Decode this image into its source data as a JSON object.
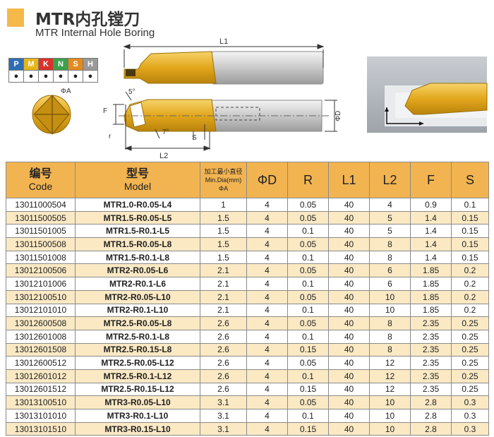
{
  "header": {
    "title_cn": "MTR内孔镗刀",
    "title_en": "MTR Internal Hole Boring",
    "accent_color": "#F5B94A"
  },
  "materials": [
    {
      "letter": "P",
      "color": "#2D6DB5",
      "mark": "●"
    },
    {
      "letter": "M",
      "color": "#E6B617",
      "mark": "●"
    },
    {
      "letter": "K",
      "color": "#D9322B",
      "mark": "●"
    },
    {
      "letter": "N",
      "color": "#3AA24A",
      "mark": "●"
    },
    {
      "letter": "S",
      "color": "#E58A1F",
      "mark": "●"
    },
    {
      "letter": "H",
      "color": "#9A9A9A",
      "mark": "●"
    }
  ],
  "diagram_labels": {
    "l1": "L1",
    "l2": "L2",
    "phi_a": "ΦA",
    "angle5": "5°",
    "angle7": "7°",
    "f": "F",
    "r": "r",
    "s": "S",
    "phi_d": "ΦD"
  },
  "table": {
    "headers": [
      {
        "cn": "编号",
        "en": "Code"
      },
      {
        "cn": "型号",
        "en": "Model"
      },
      {
        "lines": [
          "加工最小直径",
          "Min.Dia(mm)",
          "ΦA"
        ]
      },
      {
        "text": "ΦD"
      },
      {
        "text": "R"
      },
      {
        "text": "L1"
      },
      {
        "text": "L2"
      },
      {
        "text": "F"
      },
      {
        "text": "S"
      }
    ],
    "rows": [
      [
        "13011000504",
        "MTR1.0-R0.05-L4",
        "1",
        "4",
        "0.05",
        "40",
        "4",
        "0.9",
        "0.1"
      ],
      [
        "13011500505",
        "MTR1.5-R0.05-L5",
        "1.5",
        "4",
        "0.05",
        "40",
        "5",
        "1.4",
        "0.15"
      ],
      [
        "13011501005",
        "MTR1.5-R0.1-L5",
        "1.5",
        "4",
        "0.1",
        "40",
        "5",
        "1.4",
        "0.15"
      ],
      [
        "13011500508",
        "MTR1.5-R0.05-L8",
        "1.5",
        "4",
        "0.05",
        "40",
        "8",
        "1.4",
        "0.15"
      ],
      [
        "13011501008",
        "MTR1.5-R0.1-L8",
        "1.5",
        "4",
        "0.1",
        "40",
        "8",
        "1.4",
        "0.15"
      ],
      [
        "13012100506",
        "MTR2-R0.05-L6",
        "2.1",
        "4",
        "0.05",
        "40",
        "6",
        "1.85",
        "0.2"
      ],
      [
        "13012101006",
        "MTR2-R0.1-L6",
        "2.1",
        "4",
        "0.1",
        "40",
        "6",
        "1.85",
        "0.2"
      ],
      [
        "13012100510",
        "MTR2-R0.05-L10",
        "2.1",
        "4",
        "0.05",
        "40",
        "10",
        "1.85",
        "0.2"
      ],
      [
        "13012101010",
        "MTR2-R0.1-L10",
        "2.1",
        "4",
        "0.1",
        "40",
        "10",
        "1.85",
        "0.2"
      ],
      [
        "13012600508",
        "MTR2.5-R0.05-L8",
        "2.6",
        "4",
        "0.05",
        "40",
        "8",
        "2.35",
        "0.25"
      ],
      [
        "13012601008",
        "MTR2.5-R0.1-L8",
        "2.6",
        "4",
        "0.1",
        "40",
        "8",
        "2.35",
        "0.25"
      ],
      [
        "13012601508",
        "MTR2.5-R0.15-L8",
        "2.6",
        "4",
        "0.15",
        "40",
        "8",
        "2.35",
        "0.25"
      ],
      [
        "13012600512",
        "MTR2.5-R0.05-L12",
        "2.6",
        "4",
        "0.05",
        "40",
        "12",
        "2.35",
        "0.25"
      ],
      [
        "13012601012",
        "MTR2.5-R0.1-L12",
        "2.6",
        "4",
        "0.1",
        "40",
        "12",
        "2.35",
        "0.25"
      ],
      [
        "13012601512",
        "MTR2.5-R0.15-L12",
        "2.6",
        "4",
        "0.15",
        "40",
        "12",
        "2.35",
        "0.25"
      ],
      [
        "13013100510",
        "MTR3-R0.05-L10",
        "3.1",
        "4",
        "0.05",
        "40",
        "10",
        "2.8",
        "0.3"
      ],
      [
        "13013101010",
        "MTR3-R0.1-L10",
        "3.1",
        "4",
        "0.1",
        "40",
        "10",
        "2.8",
        "0.3"
      ],
      [
        "13013101510",
        "MTR3-R0.15-L10",
        "3.1",
        "4",
        "0.15",
        "40",
        "10",
        "2.8",
        "0.3"
      ]
    ]
  }
}
